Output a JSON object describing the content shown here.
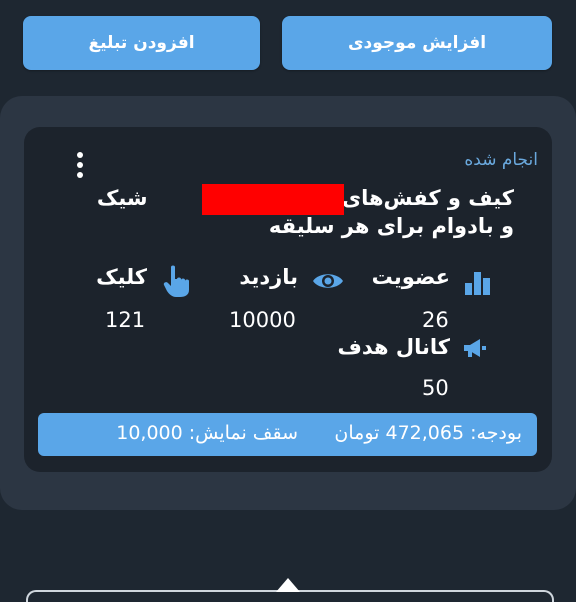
{
  "toolbar": {
    "add_balance_label": "افزایش موجودی",
    "add_ad_label": "افزودن تبلیغ"
  },
  "ad": {
    "status": "انجام شده",
    "title_line1": "کیف و کفش‌های جـ",
    "title_line1_end": "شیک",
    "title_line2": "و بادوام برای هر سلیقه",
    "stats": {
      "membership_label": "عضویت",
      "membership_value": "26",
      "views_label": "بازدید",
      "views_value": "10000",
      "clicks_label": "کلیک",
      "clicks_value": "121",
      "target_channel_label": "کانال هدف",
      "target_channel_value": "50"
    },
    "budget": {
      "budget_text": "بودجه: 472,065 تومان",
      "display_cap_text": "سقف نمایش: 10,000"
    }
  },
  "colors": {
    "background": "#1e2731",
    "panel": "#2c3643",
    "card": "#1c232c",
    "accent": "#5aa6e8",
    "status_text": "#6aa9de",
    "redaction": "#ff0000"
  },
  "icons": {
    "more": "more-vertical-icon",
    "membership": "bar-chart-icon",
    "views": "eye-icon",
    "clicks": "pointer-hand-icon",
    "target_channel": "megaphone-icon"
  }
}
